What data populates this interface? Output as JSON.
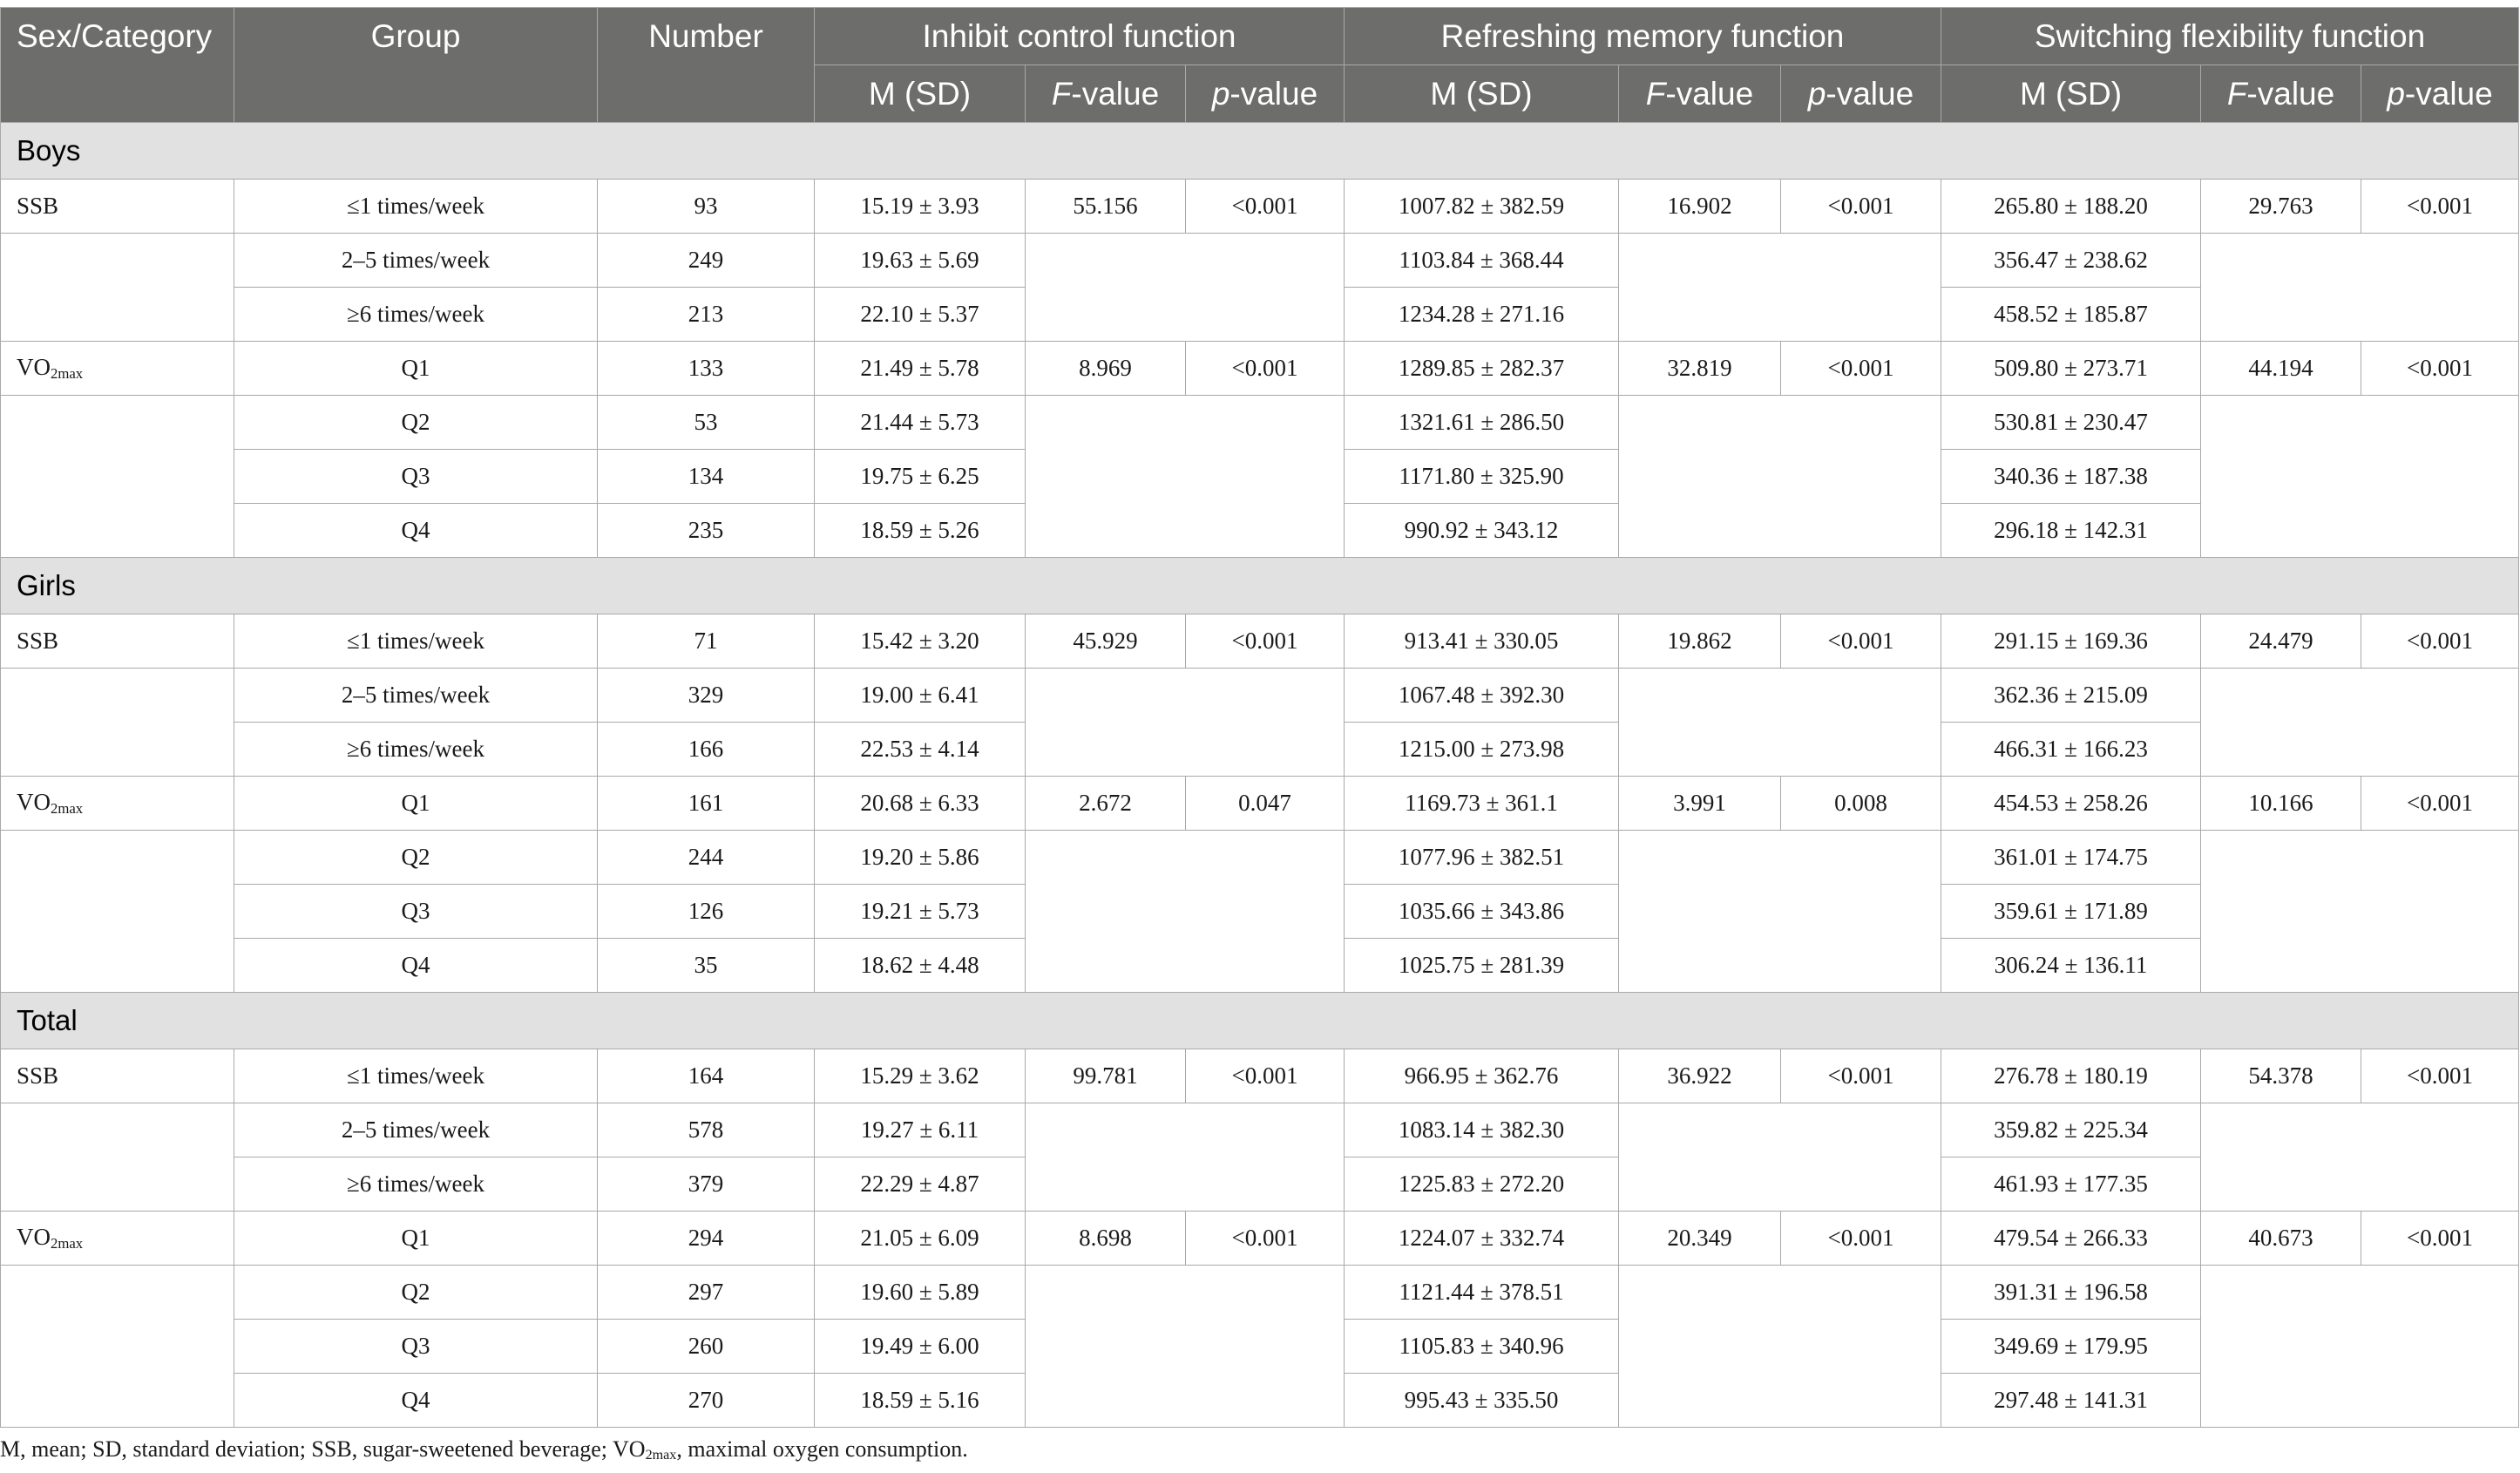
{
  "header": {
    "sex_category": "Sex/Category",
    "group": "Group",
    "number": "Number",
    "inhibit": "Inhibit control function",
    "refresh": "Refreshing memory function",
    "switching": "Switching flexibility function",
    "msd": "M (SD)",
    "f_letter": "F",
    "f_suffix": "-value",
    "p_letter": "p",
    "p_suffix": "-value"
  },
  "sections": [
    {
      "label": "Boys",
      "blocks": [
        {
          "category": "SSB",
          "stats": {
            "inhibit_f": "55.156",
            "inhibit_p": "<0.001",
            "refresh_f": "16.902",
            "refresh_p": "<0.001",
            "switch_f": "29.763",
            "switch_p": "<0.001"
          },
          "rows": [
            {
              "group": "≤1 times/week",
              "number": "93",
              "inhibit": "15.19 ± 3.93",
              "refresh": "1007.82 ± 382.59",
              "switch": "265.80 ± 188.20"
            },
            {
              "group": "2–5 times/week",
              "number": "249",
              "inhibit": "19.63 ± 5.69",
              "refresh": "1103.84 ± 368.44",
              "switch": "356.47 ± 238.62"
            },
            {
              "group": "≥6 times/week",
              "number": "213",
              "inhibit": "22.10 ± 5.37",
              "refresh": "1234.28 ± 271.16",
              "switch": "458.52 ± 185.87"
            }
          ]
        },
        {
          "category": "VO",
          "category_sub": "2max",
          "stats": {
            "inhibit_f": "8.969",
            "inhibit_p": "<0.001",
            "refresh_f": "32.819",
            "refresh_p": "<0.001",
            "switch_f": "44.194",
            "switch_p": "<0.001"
          },
          "rows": [
            {
              "group": "Q1",
              "number": "133",
              "inhibit": "21.49 ± 5.78",
              "refresh": "1289.85 ± 282.37",
              "switch": "509.80 ± 273.71"
            },
            {
              "group": "Q2",
              "number": "53",
              "inhibit": "21.44 ± 5.73",
              "refresh": "1321.61 ± 286.50",
              "switch": "530.81 ± 230.47"
            },
            {
              "group": "Q3",
              "number": "134",
              "inhibit": "19.75 ± 6.25",
              "refresh": "1171.80 ± 325.90",
              "switch": "340.36 ± 187.38"
            },
            {
              "group": "Q4",
              "number": "235",
              "inhibit": "18.59 ± 5.26",
              "refresh": "990.92 ± 343.12",
              "switch": "296.18 ± 142.31"
            }
          ]
        }
      ]
    },
    {
      "label": "Girls",
      "blocks": [
        {
          "category": "SSB",
          "stats": {
            "inhibit_f": "45.929",
            "inhibit_p": "<0.001",
            "refresh_f": "19.862",
            "refresh_p": "<0.001",
            "switch_f": "24.479",
            "switch_p": "<0.001"
          },
          "rows": [
            {
              "group": "≤1 times/week",
              "number": "71",
              "inhibit": "15.42 ± 3.20",
              "refresh": "913.41 ± 330.05",
              "switch": "291.15 ± 169.36"
            },
            {
              "group": "2–5 times/week",
              "number": "329",
              "inhibit": "19.00 ± 6.41",
              "refresh": "1067.48 ± 392.30",
              "switch": "362.36 ± 215.09"
            },
            {
              "group": "≥6 times/week",
              "number": "166",
              "inhibit": "22.53 ± 4.14",
              "refresh": "1215.00 ± 273.98",
              "switch": "466.31 ± 166.23"
            }
          ]
        },
        {
          "category": "VO",
          "category_sub": "2max",
          "stats": {
            "inhibit_f": "2.672",
            "inhibit_p": "0.047",
            "refresh_f": "3.991",
            "refresh_p": "0.008",
            "switch_f": "10.166",
            "switch_p": "<0.001"
          },
          "rows": [
            {
              "group": "Q1",
              "number": "161",
              "inhibit": "20.68 ± 6.33",
              "refresh": "1169.73 ± 361.1",
              "switch": "454.53 ± 258.26"
            },
            {
              "group": "Q2",
              "number": "244",
              "inhibit": "19.20 ± 5.86",
              "refresh": "1077.96 ± 382.51",
              "switch": "361.01 ± 174.75"
            },
            {
              "group": "Q3",
              "number": "126",
              "inhibit": "19.21 ± 5.73",
              "refresh": "1035.66 ± 343.86",
              "switch": "359.61 ± 171.89"
            },
            {
              "group": "Q4",
              "number": "35",
              "inhibit": "18.62 ± 4.48",
              "refresh": "1025.75 ± 281.39",
              "switch": "306.24 ± 136.11"
            }
          ]
        }
      ]
    },
    {
      "label": "Total",
      "blocks": [
        {
          "category": "SSB",
          "stats": {
            "inhibit_f": "99.781",
            "inhibit_p": "<0.001",
            "refresh_f": "36.922",
            "refresh_p": "<0.001",
            "switch_f": "54.378",
            "switch_p": "<0.001"
          },
          "rows": [
            {
              "group": "≤1 times/week",
              "number": "164",
              "inhibit": "15.29 ± 3.62",
              "refresh": "966.95 ± 362.76",
              "switch": "276.78 ± 180.19"
            },
            {
              "group": "2–5 times/week",
              "number": "578",
              "inhibit": "19.27 ± 6.11",
              "refresh": "1083.14 ± 382.30",
              "switch": "359.82 ± 225.34"
            },
            {
              "group": "≥6 times/week",
              "number": "379",
              "inhibit": "22.29 ± 4.87",
              "refresh": "1225.83 ± 272.20",
              "switch": "461.93 ± 177.35"
            }
          ]
        },
        {
          "category": "VO",
          "category_sub": "2max",
          "stats": {
            "inhibit_f": "8.698",
            "inhibit_p": "<0.001",
            "refresh_f": "20.349",
            "refresh_p": "<0.001",
            "switch_f": "40.673",
            "switch_p": "<0.001"
          },
          "rows": [
            {
              "group": "Q1",
              "number": "294",
              "inhibit": "21.05 ± 6.09",
              "refresh": "1224.07 ± 332.74",
              "switch": "479.54 ± 266.33"
            },
            {
              "group": "Q2",
              "number": "297",
              "inhibit": "19.60 ± 5.89",
              "refresh": "1121.44 ± 378.51",
              "switch": "391.31 ± 196.58"
            },
            {
              "group": "Q3",
              "number": "260",
              "inhibit": "19.49 ± 6.00",
              "refresh": "1105.83 ± 340.96",
              "switch": "349.69 ± 179.95"
            },
            {
              "group": "Q4",
              "number": "270",
              "inhibit": "18.59 ± 5.16",
              "refresh": "995.43 ± 335.50",
              "switch": "297.48 ± 141.31"
            }
          ]
        }
      ]
    }
  ],
  "footnote": {
    "text_before": "M, mean; SD, standard deviation; SSB, sugar-sweetened beverage; VO",
    "sub": "2max",
    "text_after": ", maximal oxygen consumption."
  }
}
